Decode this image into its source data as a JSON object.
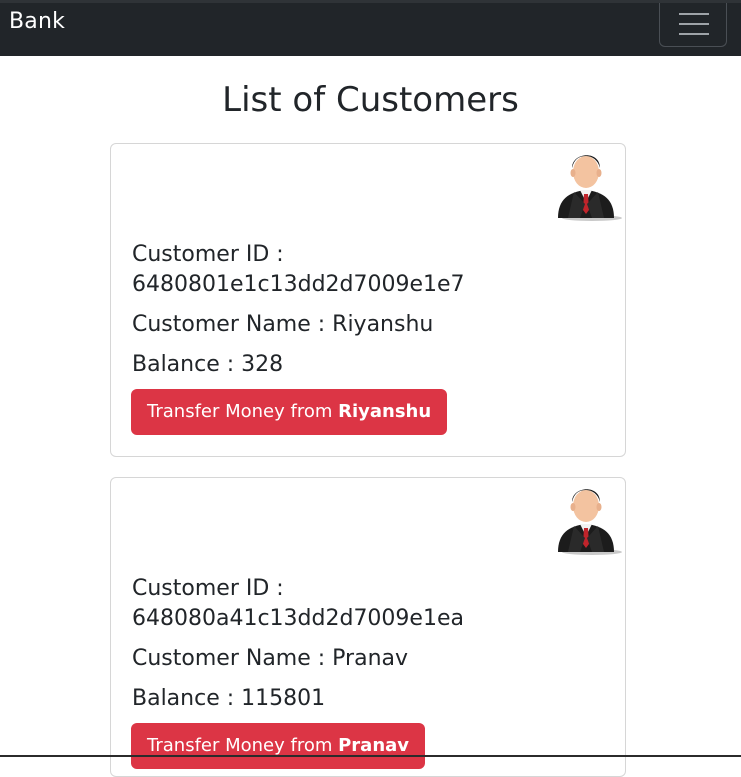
{
  "navbar": {
    "brand": "Bank",
    "toggler_icon": "hamburger-menu-icon"
  },
  "page_title": "List of Customers",
  "customers": [
    {
      "id_label": "Customer ID :",
      "id": "6480801e1c13dd2d7009e1e7",
      "name_line": "Customer Name : Riyanshu",
      "balance_line": "Balance : 328",
      "button_prefix": "Transfer Money from ",
      "button_name": "Riyanshu",
      "avatar_icon": "businessman-avatar-icon"
    },
    {
      "id_label": "Customer ID :",
      "id": "648080a41c13dd2d7009e1ea",
      "name_line": "Customer Name : Pranav",
      "balance_line": "Balance : 115801",
      "button_prefix": "Transfer Money from ",
      "button_name": "Pranav",
      "avatar_icon": "businessman-avatar-icon"
    }
  ],
  "colors": {
    "navbar": "#212529",
    "button": "#dc3545",
    "text": "#212529"
  }
}
